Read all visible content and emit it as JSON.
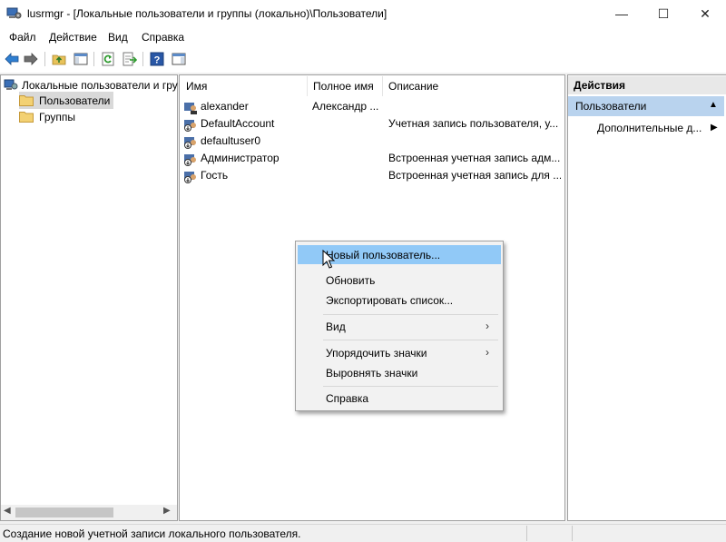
{
  "window": {
    "title": "lusrmgr - [Локальные пользователи и группы (локально)\\Пользователи]",
    "minimize": "—",
    "maximize": "☐",
    "close": "✕"
  },
  "menu": [
    "Файл",
    "Действие",
    "Вид",
    "Справка"
  ],
  "toolbar_icons": [
    "back-arrow-icon",
    "forward-arrow-icon",
    "up-folder-icon",
    "show-hide-tree-icon",
    "refresh-icon",
    "export-list-icon",
    "help-icon",
    "view-icon"
  ],
  "tree": {
    "root": "Локальные пользователи и гру",
    "items": [
      "Пользователи",
      "Группы"
    ]
  },
  "list": {
    "columns": [
      "Имя",
      "Полное имя",
      "Описание"
    ],
    "rows": [
      {
        "name": "alexander",
        "fullname": "Александр ...",
        "description": ""
      },
      {
        "name": "DefaultAccount",
        "fullname": "",
        "description": "Учетная запись пользователя, у..."
      },
      {
        "name": "defaultuser0",
        "fullname": "",
        "description": ""
      },
      {
        "name": "Администратор",
        "fullname": "",
        "description": "Встроенная учетная запись адм..."
      },
      {
        "name": "Гость",
        "fullname": "",
        "description": "Встроенная учетная запись для ..."
      }
    ]
  },
  "actions": {
    "header": "Действия",
    "section": "Пользователи",
    "more": "Дополнительные д..."
  },
  "context_menu": {
    "items": [
      "Новый пользователь...",
      "Обновить",
      "Экспортировать список...",
      "Вид",
      "Упорядочить значки",
      "Выровнять значки",
      "Справка"
    ]
  },
  "status": {
    "text": "Создание новой учетной записи локального пользователя."
  },
  "colors": {
    "menu_highlight": "#91c9f7",
    "actions_section": "#b9d3ee",
    "selected_tree": "#d9d9d9"
  }
}
